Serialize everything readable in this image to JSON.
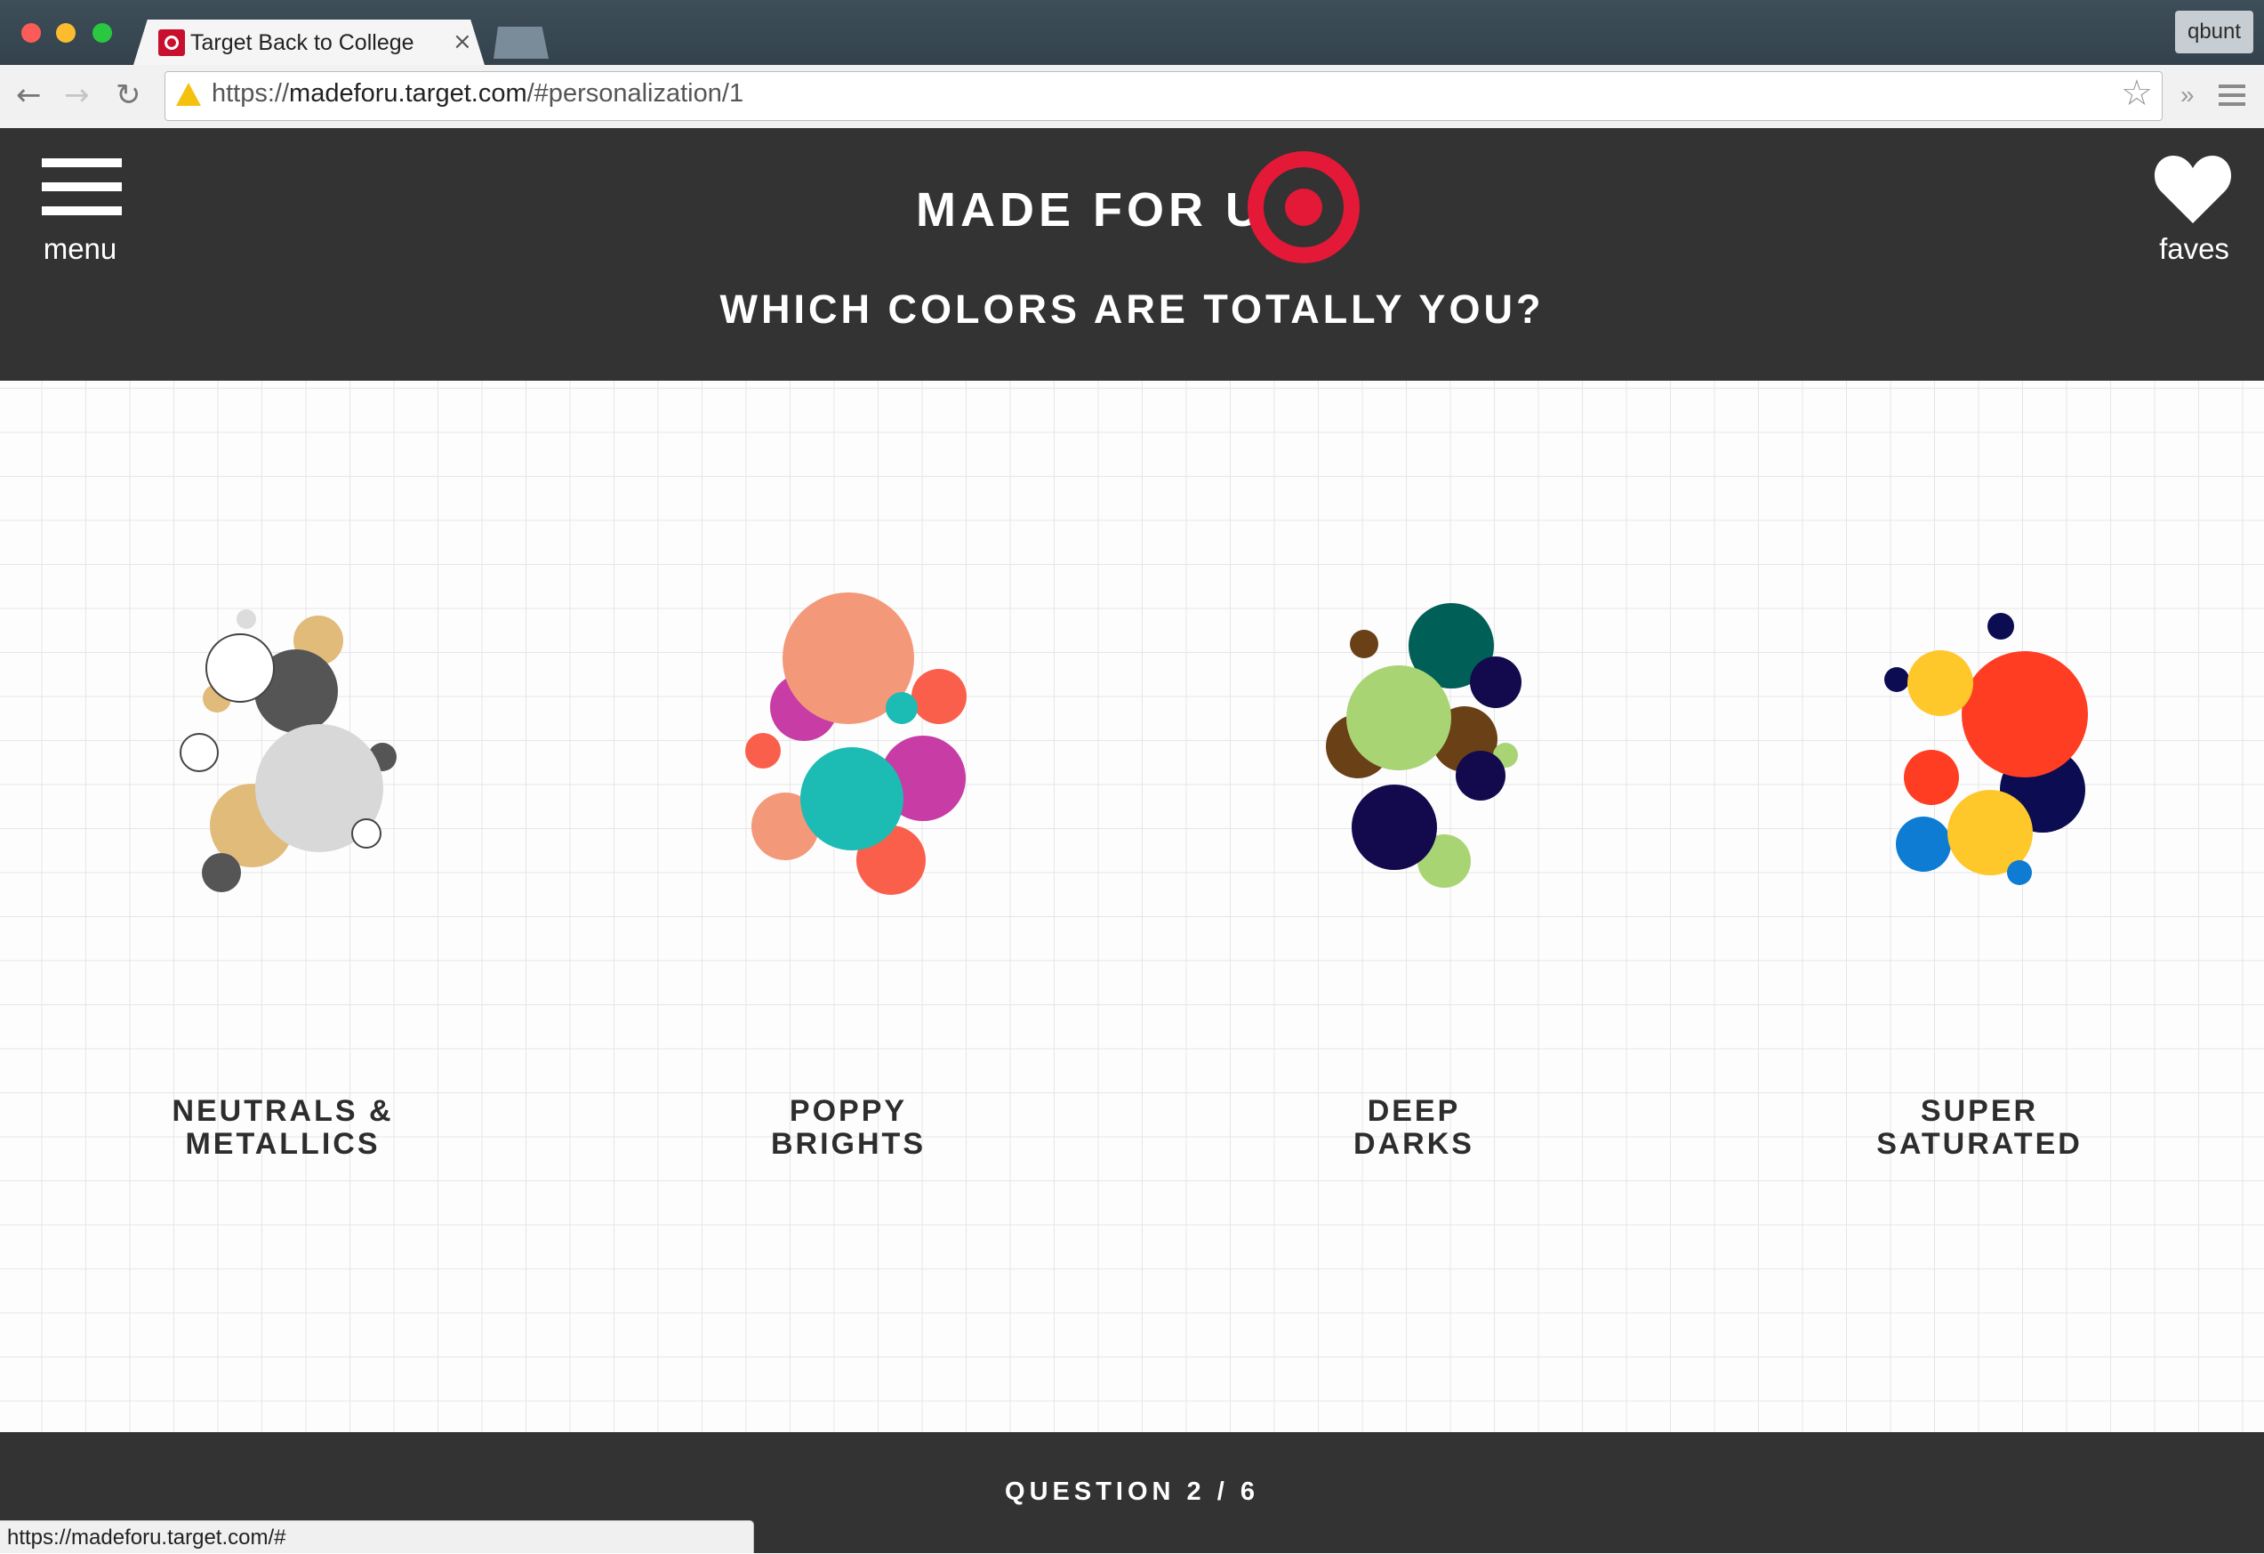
{
  "browser": {
    "tab_title": "Target Back to College",
    "tab_close": "×",
    "profile_name": "qbunt",
    "url_scheme": "https://",
    "url_host": "madeforu.target.com",
    "url_path": "/#personalization/1",
    "status_url": "https://madeforu.target.com/#"
  },
  "header": {
    "menu_label": "menu",
    "brand": "MADE FOR U",
    "question": "WHICH COLORS ARE TOTALLY YOU?",
    "faves_label": "faves",
    "brand_color": "#e31937"
  },
  "options": [
    {
      "label_line1": "NEUTRALS &",
      "label_line2": "METALLICS",
      "palette": [
        "#555555",
        "#d8d8d8",
        "#e0bb7a",
        "#ffffff",
        "#dcdcdc"
      ]
    },
    {
      "label_line1": "POPPY",
      "label_line2": "BRIGHTS",
      "palette": [
        "#f4987a",
        "#c73ca5",
        "#1cbbb4",
        "#fa5f4c"
      ]
    },
    {
      "label_line1": "DEEP",
      "label_line2": "DARKS",
      "palette": [
        "#005f56",
        "#6a4016",
        "#a9d474",
        "#120a4d"
      ]
    },
    {
      "label_line1": "SUPER",
      "label_line2": "SATURATED",
      "palette": [
        "#ff3d22",
        "#fec72a",
        "#0c0c52",
        "#0d7cd2"
      ]
    }
  ],
  "footer": {
    "progress_label": "QUESTION 2 / 6"
  }
}
